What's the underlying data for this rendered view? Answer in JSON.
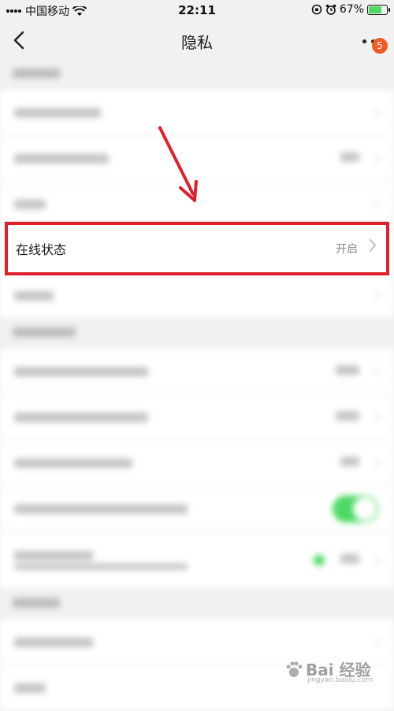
{
  "status_bar": {
    "carrier": "中国移动",
    "time": "22:11",
    "battery_percent": "67%"
  },
  "nav": {
    "title": "隐私",
    "badge_count": "5"
  },
  "highlighted_row": {
    "label": "在线状态",
    "value": "开启"
  },
  "watermark": {
    "brand": "Bai 经验",
    "sub": "jingyan.baidu.com"
  },
  "colors": {
    "highlight_border": "#e01e2c",
    "badge": "#f15a24",
    "toggle_on": "#4cd964"
  }
}
